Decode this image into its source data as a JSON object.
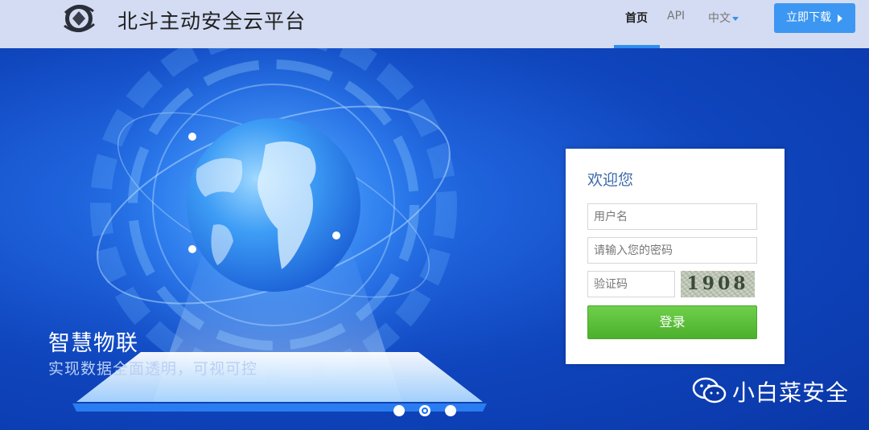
{
  "header": {
    "title": "北斗主动安全云平台",
    "logo_icon": "globe-shield-logo",
    "nav": {
      "home": "首页",
      "api": "API",
      "language": "中文"
    },
    "download_label": "立即下载",
    "accent": "#2f8ef0"
  },
  "hero": {
    "title": "智慧物联",
    "subtitle": "实现数据全面透明，可视可控",
    "carousel_active_index": 2,
    "carousel_count": 3
  },
  "login": {
    "title": "欢迎您",
    "username_placeholder": "用户名",
    "password_placeholder": "请输入您的密码",
    "captcha_placeholder": "验证码",
    "captcha_text": "1908",
    "submit_label": "登录",
    "submit_color": "#5cc13a"
  },
  "watermark": {
    "icon": "wechat-icon",
    "text": "小白菜安全"
  }
}
